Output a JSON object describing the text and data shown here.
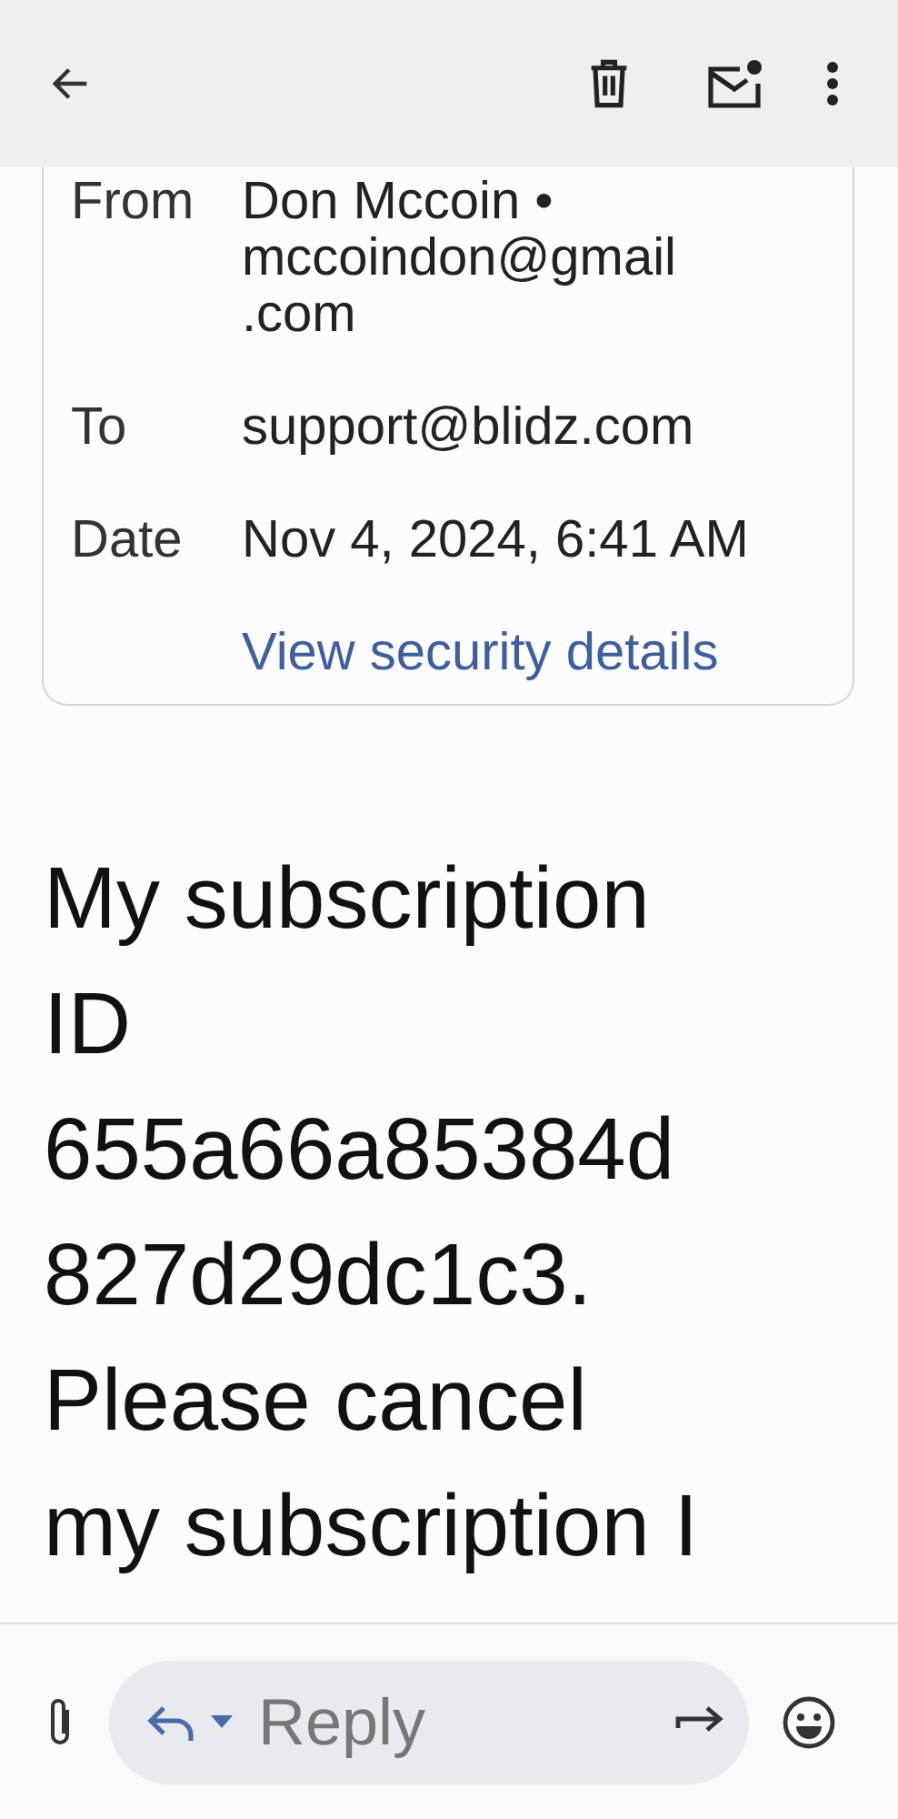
{
  "header": {
    "from_label": "From",
    "from_name": "Don Mccoin •",
    "from_email": "mccoindon@gmail.com",
    "to_label": "To",
    "to_value": "support@blidz.com",
    "date_label": "Date",
    "date_value": "Nov 4, 2024, 6:41 AM",
    "security_link": "View security details"
  },
  "body_lines": [
    "My subscription",
    "ID",
    "655a66a85384d",
    "827d29dc1c3.",
    "Please cancel",
    "my subscription I"
  ],
  "reply_bar": {
    "placeholder": "Reply"
  }
}
